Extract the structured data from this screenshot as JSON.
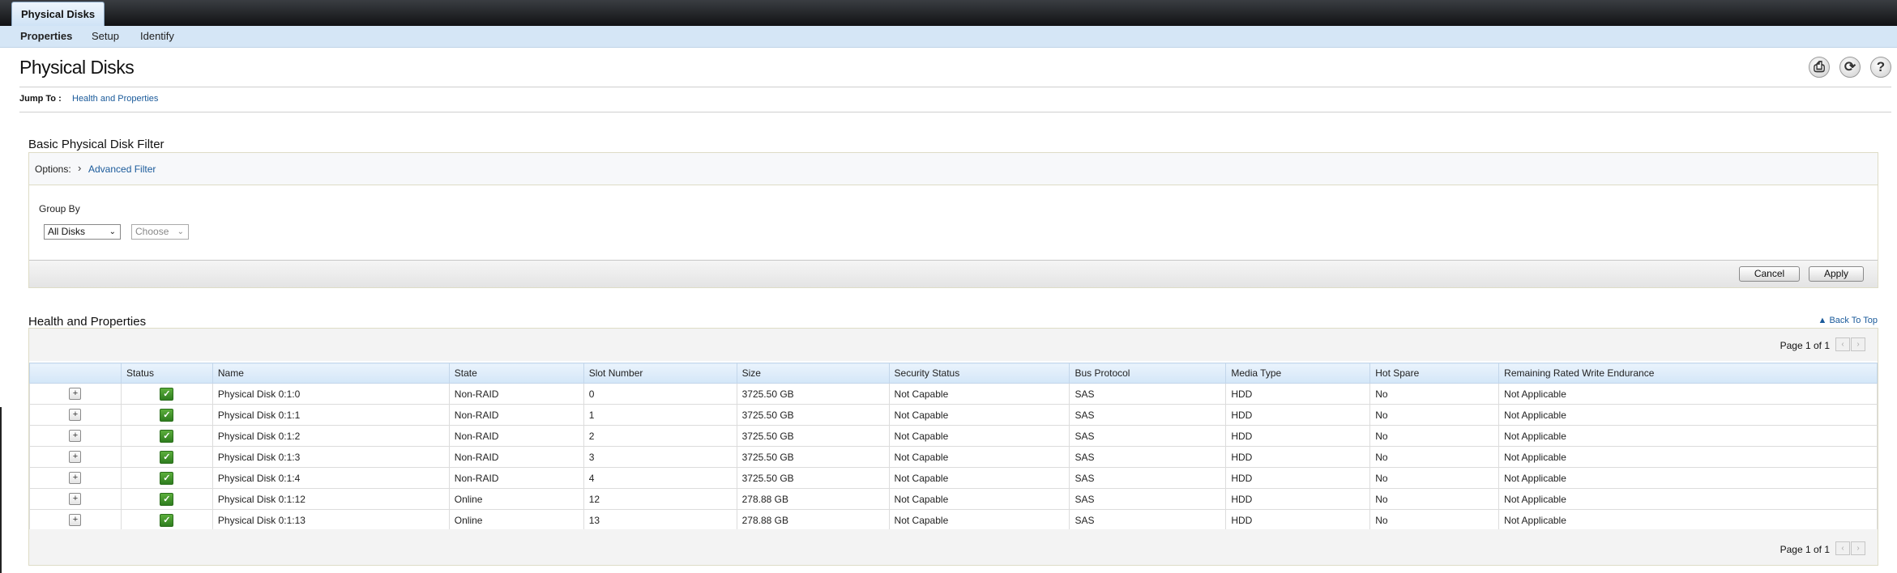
{
  "tabbar": {
    "active_tab": "Physical Disks"
  },
  "subnav": {
    "items": [
      "Properties",
      "Setup",
      "Identify"
    ]
  },
  "page": {
    "title": "Physical Disks"
  },
  "toolbar": {
    "print_glyph": "⎙",
    "refresh_glyph": "⟳",
    "help_glyph": "?"
  },
  "jump": {
    "label": "Jump To :",
    "link": "Health and Properties"
  },
  "filter": {
    "title": "Basic Physical Disk Filter",
    "options_label": "Options:",
    "chevron": "›",
    "advanced_link": "Advanced Filter",
    "group_by_label": "Group By",
    "group_select_value": "All Disks",
    "choose_select_value": "Choose",
    "cancel_label": "Cancel",
    "apply_label": "Apply"
  },
  "health": {
    "title": "Health and Properties",
    "back_to_top": "▲ Back To Top",
    "pager_text": "Page 1 of 1",
    "prev_glyph": "‹",
    "next_glyph": "›",
    "columns": [
      "",
      "Status",
      "Name",
      "State",
      "Slot Number",
      "Size",
      "Security Status",
      "Bus Protocol",
      "Media Type",
      "Hot Spare",
      "Remaining Rated Write Endurance"
    ],
    "rows": [
      {
        "expand": "+",
        "status": "✓",
        "name": "Physical Disk 0:1:0",
        "state": "Non-RAID",
        "slot": "0",
        "size": "3725.50 GB",
        "security": "Not Capable",
        "bus": "SAS",
        "media": "HDD",
        "hot_spare": "No",
        "endurance": "Not Applicable"
      },
      {
        "expand": "+",
        "status": "✓",
        "name": "Physical Disk 0:1:1",
        "state": "Non-RAID",
        "slot": "1",
        "size": "3725.50 GB",
        "security": "Not Capable",
        "bus": "SAS",
        "media": "HDD",
        "hot_spare": "No",
        "endurance": "Not Applicable"
      },
      {
        "expand": "+",
        "status": "✓",
        "name": "Physical Disk 0:1:2",
        "state": "Non-RAID",
        "slot": "2",
        "size": "3725.50 GB",
        "security": "Not Capable",
        "bus": "SAS",
        "media": "HDD",
        "hot_spare": "No",
        "endurance": "Not Applicable"
      },
      {
        "expand": "+",
        "status": "✓",
        "name": "Physical Disk 0:1:3",
        "state": "Non-RAID",
        "slot": "3",
        "size": "3725.50 GB",
        "security": "Not Capable",
        "bus": "SAS",
        "media": "HDD",
        "hot_spare": "No",
        "endurance": "Not Applicable"
      },
      {
        "expand": "+",
        "status": "✓",
        "name": "Physical Disk 0:1:4",
        "state": "Non-RAID",
        "slot": "4",
        "size": "3725.50 GB",
        "security": "Not Capable",
        "bus": "SAS",
        "media": "HDD",
        "hot_spare": "No",
        "endurance": "Not Applicable"
      },
      {
        "expand": "+",
        "status": "✓",
        "name": "Physical Disk 0:1:12",
        "state": "Online",
        "slot": "12",
        "size": "278.88 GB",
        "security": "Not Capable",
        "bus": "SAS",
        "media": "HDD",
        "hot_spare": "No",
        "endurance": "Not Applicable"
      },
      {
        "expand": "+",
        "status": "✓",
        "name": "Physical Disk 0:1:13",
        "state": "Online",
        "slot": "13",
        "size": "278.88 GB",
        "security": "Not Capable",
        "bus": "SAS",
        "media": "HDD",
        "hot_spare": "No",
        "endurance": "Not Applicable"
      }
    ]
  }
}
